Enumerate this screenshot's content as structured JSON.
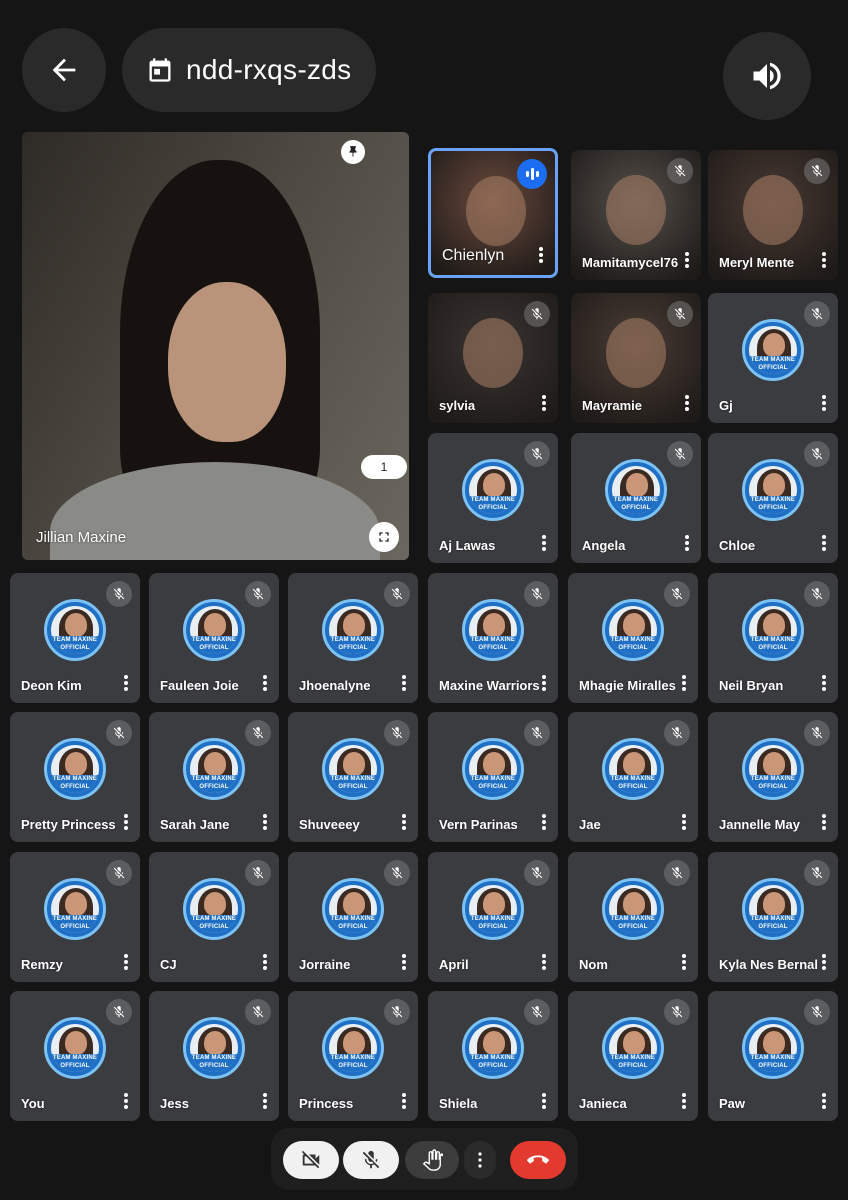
{
  "header": {
    "meeting_code": "ndd-rxqs-zds",
    "back_icon": "arrow-back-icon",
    "calendar_icon": "calendar-icon",
    "speaker_icon": "volume-icon"
  },
  "main_tile": {
    "name": "Jillian Maxine",
    "count_badge": "1",
    "pin_icon": "pin-icon",
    "fullscreen_icon": "fullscreen-icon"
  },
  "video_tiles": [
    {
      "name": "Chienlyn",
      "speaking": true
    },
    {
      "name": "Mamitamycel76"
    },
    {
      "name": "Meryl Mente"
    },
    {
      "name": "sylvia"
    },
    {
      "name": "Mayramie"
    }
  ],
  "avatar_text": "TEAM MAXINE OFFICIAL",
  "avatar_tiles": [
    {
      "name": "Gj"
    },
    {
      "name": "Aj Lawas"
    },
    {
      "name": "Angela"
    },
    {
      "name": "Chloe"
    },
    {
      "name": "Deon Kim"
    },
    {
      "name": "Fauleen Joie"
    },
    {
      "name": "Jhoenalyne"
    },
    {
      "name": "Maxine Warriors"
    },
    {
      "name": "Mhagie Miralles"
    },
    {
      "name": "Neil Bryan"
    },
    {
      "name": "Pretty Princess"
    },
    {
      "name": "Sarah Jane"
    },
    {
      "name": "Shuveeey"
    },
    {
      "name": "Vern Parinas"
    },
    {
      "name": "Jae"
    },
    {
      "name": "Jannelle May"
    },
    {
      "name": "Remzy"
    },
    {
      "name": "CJ"
    },
    {
      "name": "Jorraine"
    },
    {
      "name": "April"
    },
    {
      "name": "Nom"
    },
    {
      "name": "Kyla Nes Bernal"
    },
    {
      "name": "You"
    },
    {
      "name": "Jess"
    },
    {
      "name": "Princess"
    },
    {
      "name": "Shiela"
    },
    {
      "name": "Janieca"
    },
    {
      "name": "Paw"
    }
  ],
  "controls": {
    "camera_icon": "camera-off-icon",
    "mic_icon": "mic-off-icon",
    "hand_icon": "raise-hand-icon",
    "more_icon": "more-vert-icon",
    "end_call_icon": "end-call-icon",
    "end_call_color": "#e33a30"
  },
  "colors": {
    "background": "#151515",
    "tile": "#3b3c3f",
    "speaking_border": "#6aa2f8",
    "avatar_blue": "#1f6fc4"
  }
}
